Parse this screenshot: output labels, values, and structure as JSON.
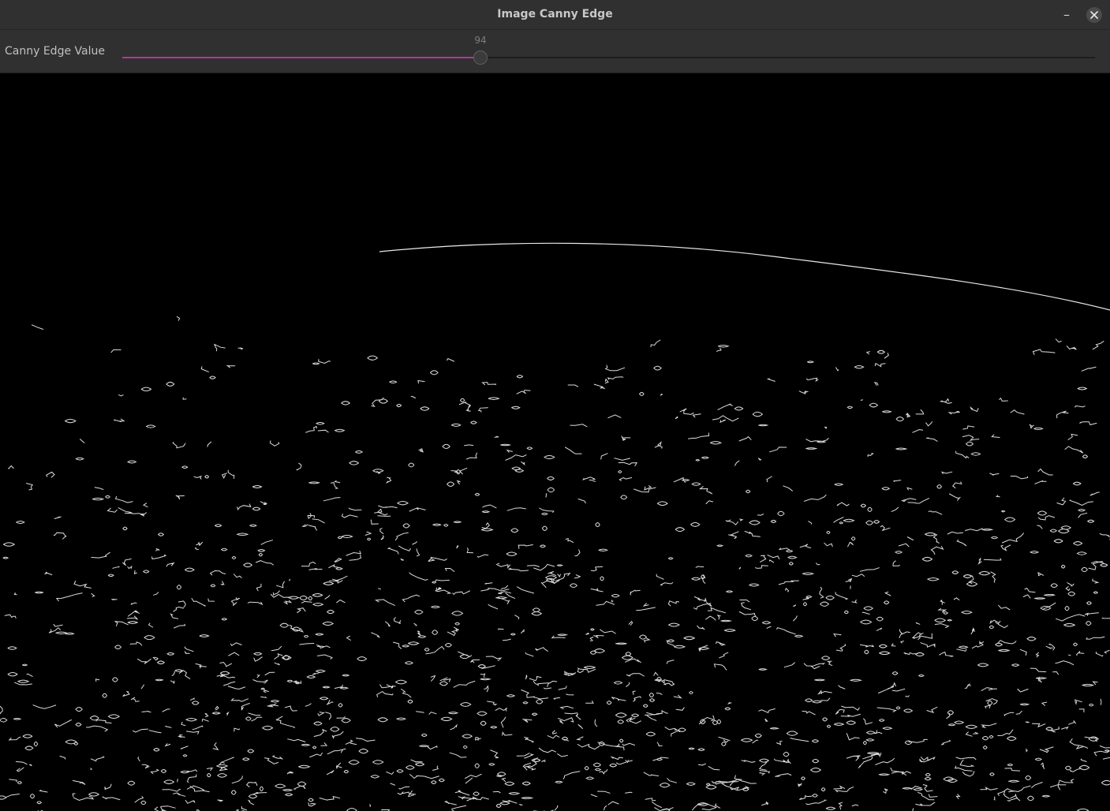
{
  "window": {
    "title": "Image Canny Edge"
  },
  "toolbar": {
    "slider_label": "Canny Edge Value",
    "slider_value": "94",
    "slider_fraction": 0.368,
    "accent_color": "#b5369a"
  },
  "icons": {
    "minimize": "minimize-icon",
    "close": "close-icon"
  },
  "image": {
    "content": "canny-edge-output"
  }
}
